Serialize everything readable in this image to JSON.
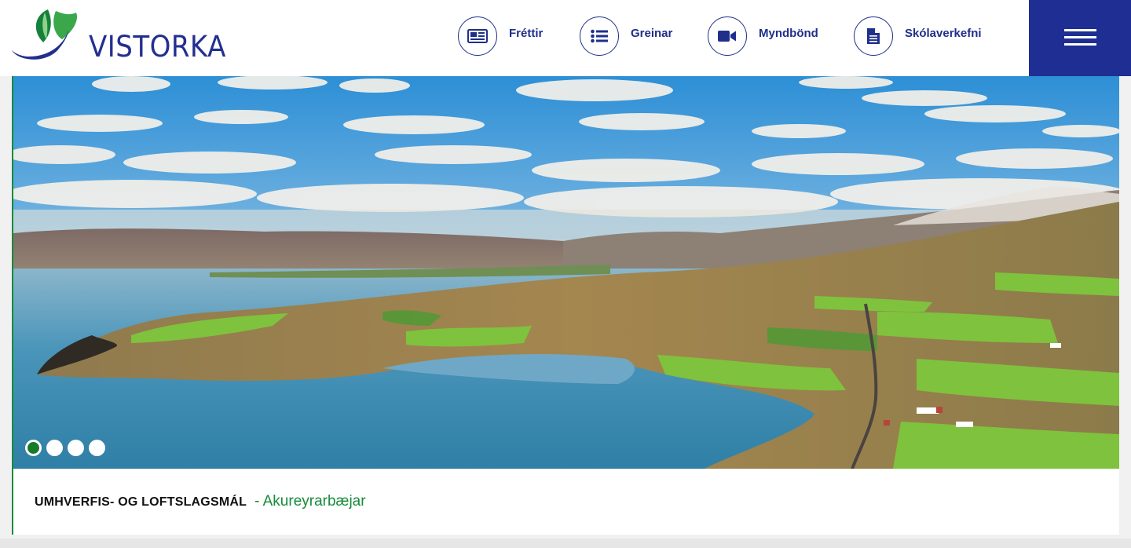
{
  "brand": {
    "name": "VISTORKA"
  },
  "nav": {
    "items": [
      {
        "label": "Fréttir",
        "icon": "newspaper-icon"
      },
      {
        "label": "Greinar",
        "icon": "list-icon"
      },
      {
        "label": "Myndbönd",
        "icon": "video-camera-icon"
      },
      {
        "label": "Skólaverkefni",
        "icon": "document-icon"
      }
    ],
    "menu_icon": "hamburger-menu-icon"
  },
  "slider": {
    "slide_count": 4,
    "active_index": 0,
    "image": "aerial-fjord-landscape",
    "caption_title": "UMHVERFIS- OG LOFTSLAGSMÁL",
    "caption_sub": "- Akureyrarbæjar"
  },
  "colors": {
    "brand_blue": "#1e2e93",
    "brand_green": "#168b3a",
    "nav_text": "#1f2f8a"
  }
}
